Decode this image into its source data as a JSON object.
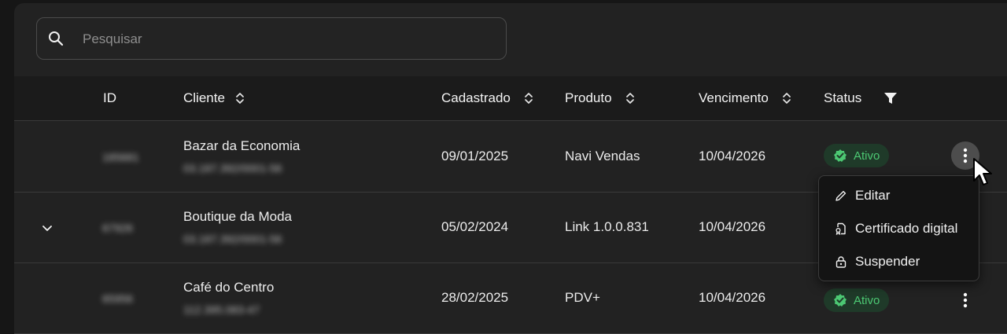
{
  "search": {
    "placeholder": "Pesquisar",
    "icon": "search-icon"
  },
  "table": {
    "headers": {
      "id": "ID",
      "cliente": "Cliente",
      "cadastrado": "Cadastrado",
      "produto": "Produto",
      "vencimento": "Vencimento",
      "status": "Status"
    },
    "rows": [
      {
        "id": "185681",
        "cliente": "Bazar da Economia",
        "documento": "03.187.392/0001-56",
        "cadastrado": "09/01/2025",
        "produto": "Navi Vendas",
        "vencimento": "10/04/2026",
        "status": "Ativo"
      },
      {
        "id": "67926",
        "cliente": "Boutique da Moda",
        "documento": "03.187.392/0001-56",
        "cadastrado": "05/02/2024",
        "produto": "Link 1.0.0.831",
        "vencimento": "10/04/2026",
        "status": ""
      },
      {
        "id": "65956",
        "cliente": "Café do Centro",
        "documento": "112.395.083-47",
        "cadastrado": "28/02/2025",
        "produto": "PDV+",
        "vencimento": "10/04/2026",
        "status": "Ativo"
      }
    ]
  },
  "menu": {
    "items": [
      {
        "label": "Editar",
        "icon": "pencil-icon"
      },
      {
        "label": "Certificado digital",
        "icon": "certificate-icon"
      },
      {
        "label": "Suspender",
        "icon": "lock-icon"
      }
    ]
  },
  "colors": {
    "background": "#222222",
    "header": "#1b1b1b",
    "status_green": "#4cc873",
    "badge_bg": "#1f3a29"
  }
}
